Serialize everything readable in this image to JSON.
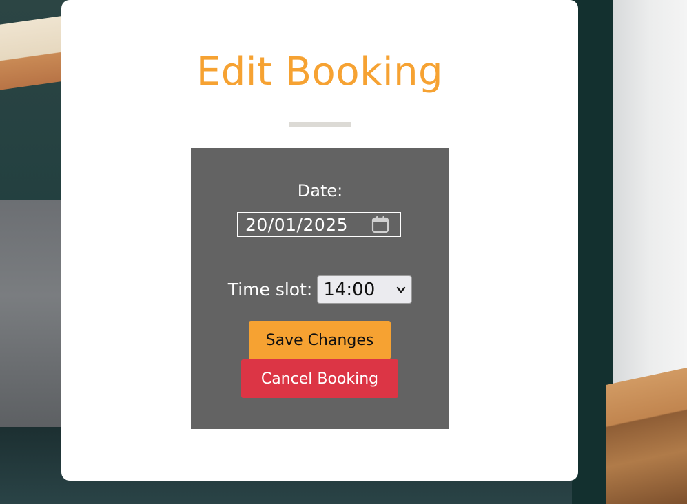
{
  "page": {
    "title": "Edit Booking",
    "accent_color": "#f6a232",
    "danger_color": "#dc3545"
  },
  "form": {
    "date_label": "Date:",
    "date_value": "20/01/2025",
    "date_icon": "calendar-icon",
    "time_label": "Time slot:",
    "time_value": "14:00",
    "time_icon": "chevron-down-icon",
    "save_label": "Save Changes",
    "cancel_label": "Cancel Booking"
  }
}
